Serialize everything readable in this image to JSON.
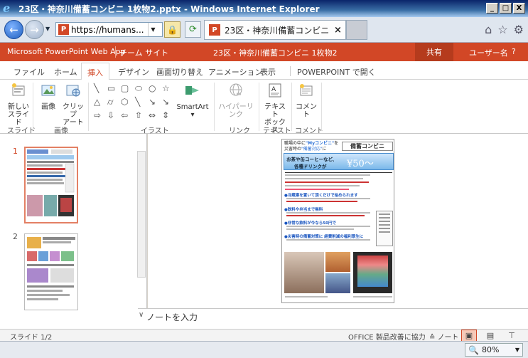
{
  "window": {
    "title": "23区・神奈川備蓄コンビニ 1枚物2.pptx - Windows Internet Explorer",
    "buttons": {
      "minimize": "_",
      "maximize": "□",
      "close": "X"
    }
  },
  "browser": {
    "url": "https://humans...",
    "tab_title": "23区・神奈川備蓄コンビニ 1...",
    "tab_close": "×",
    "pp_badge": "P"
  },
  "app": {
    "name": "Microsoft PowerPoint Web App",
    "team_site": "チーム サイト",
    "document": "23区・神奈川備蓄コンビニ 1枚物2",
    "share": "共有",
    "user": "ユーザー名",
    "help": "?",
    "accent_color": "#d24726"
  },
  "ribbon_tabs": [
    "ファイル",
    "ホーム",
    "挿入",
    "デザイン",
    "画面切り替え",
    "アニメーション",
    "表示",
    "POWERPOINT で開く"
  ],
  "ribbon": {
    "new_slide": [
      "新しい",
      "スライド"
    ],
    "picture": "画像",
    "clip_art": [
      "クリップ",
      "アート"
    ],
    "smartart": "SmartArt",
    "hyperlink": "ハイパーリンク",
    "textbox": [
      "テキスト",
      "ボックス"
    ],
    "comment": "コメント",
    "groups": {
      "slide": "スライド",
      "images": "画像",
      "illustration": "イラスト",
      "link": "リンク",
      "text": "テキスト",
      "comment": "コメント"
    }
  },
  "thumbnails": [
    {
      "number": "1",
      "selected": true
    },
    {
      "number": "2",
      "selected": false
    }
  ],
  "slide": {
    "header_line1": "職場の中に",
    "header_my": "\"Myコンビニ\"",
    "header_wo": "を",
    "header_line2": "災害時の",
    "header_bichiku": "\"備蓄対応\"",
    "header_ni": "に",
    "brand": "備蓄コンビニ",
    "banner_line1": "お茶や缶コーヒーなど、",
    "banner_line2": "各種ドリンクが",
    "price": "¥50～",
    "section1": "●冷蔵庫を置いて頂くだけで始められます",
    "section2": "●飲料や弁当まで無料",
    "section3": "●非常な飲料が今なら50円で",
    "section4": "●災害時の備蓄対策に 経費削減の福利厚生に"
  },
  "notes_placeholder": "ノートを入力",
  "status": {
    "slide_count": "スライド 1/2",
    "feedback": "OFFICE 製品改善に協力",
    "notes_btn": "ノート"
  },
  "zoom": "80%"
}
